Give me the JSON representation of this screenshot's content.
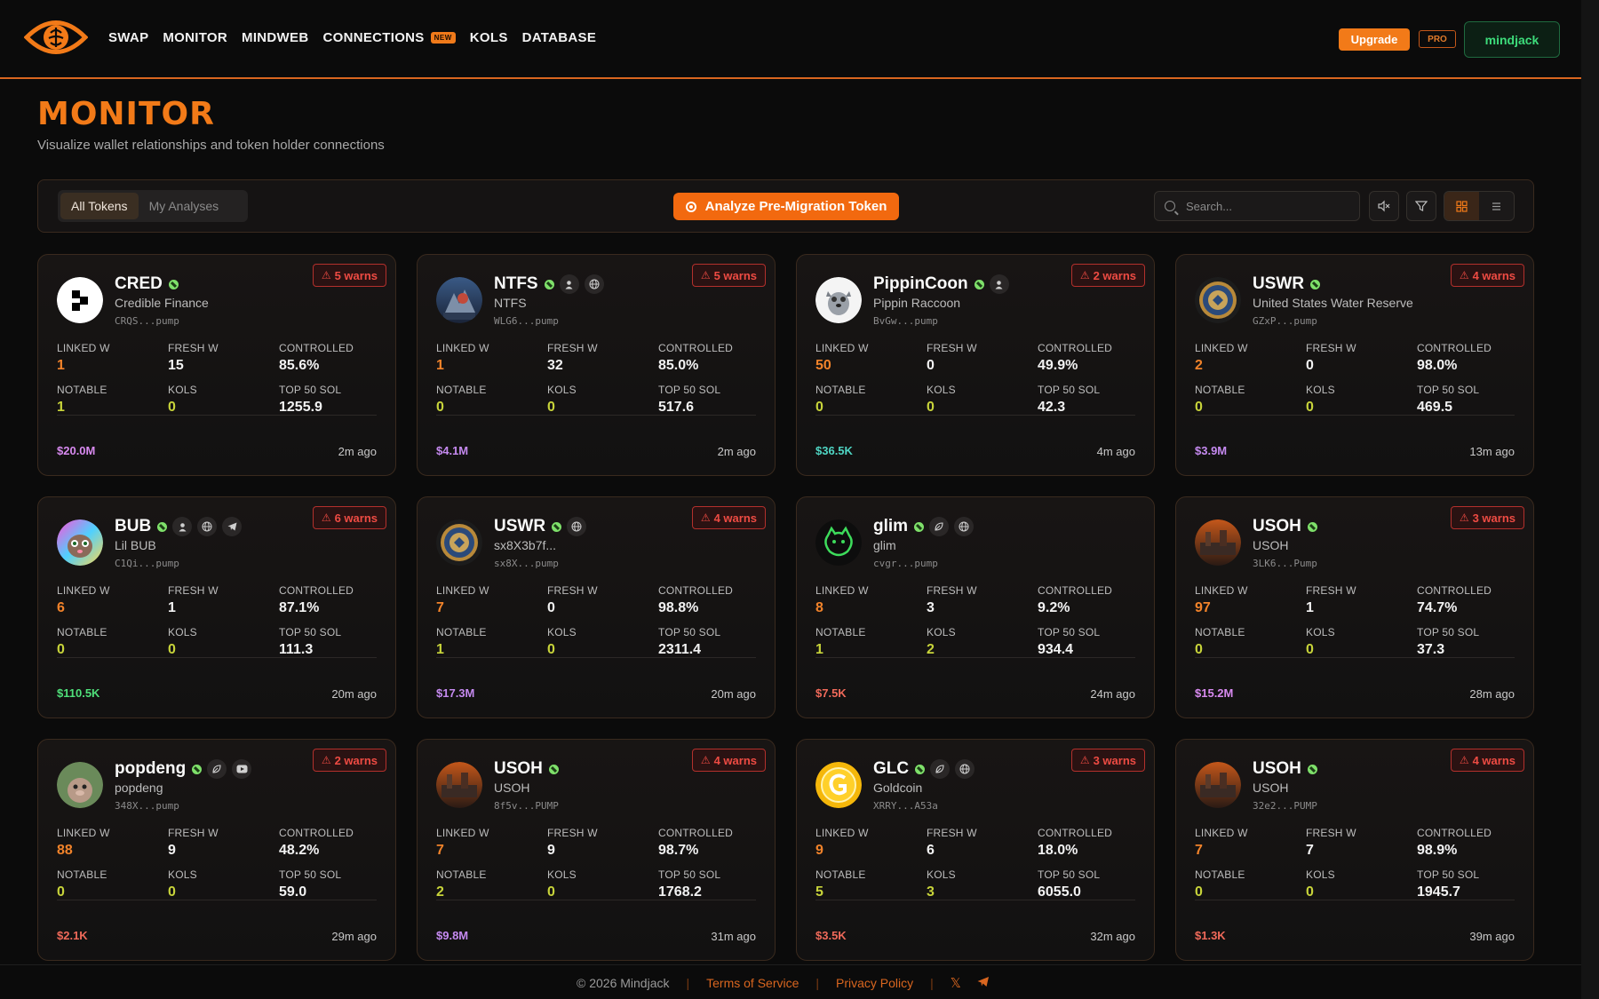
{
  "nav": {
    "items": [
      {
        "label": "SWAP"
      },
      {
        "label": "MONITOR"
      },
      {
        "label": "MINDWEB"
      },
      {
        "label": "CONNECTIONS",
        "badge": "NEW"
      },
      {
        "label": "KOLS"
      },
      {
        "label": "DATABASE"
      }
    ],
    "upgrade_label": "Upgrade",
    "pro_label": "PRO",
    "user_label": "mindjack"
  },
  "page": {
    "title": "MONITOR",
    "subtitle": "Visualize wallet relationships and token holder connections"
  },
  "toolbar": {
    "tabs": [
      {
        "label": "All Tokens",
        "active": true
      },
      {
        "label": "My Analyses",
        "active": false
      }
    ],
    "analyze_label": "Analyze Pre-Migration Token",
    "search_placeholder": "Search..."
  },
  "stat_labels": {
    "linked": "LINKED W",
    "fresh": "FRESH W",
    "controlled": "CONTROLLED",
    "notable": "NOTABLE",
    "kols": "KOLS",
    "top50": "TOP 50 SOL"
  },
  "colors": {
    "accent": "#f27a18",
    "warn": "#ee4b43",
    "green": "#3ddc7b"
  },
  "cards": [
    {
      "symbol": "CRED",
      "name": "Credible Finance",
      "address": "CRQS...pump",
      "warns": "5 warns",
      "socials": [],
      "avatar": "cred",
      "linked": "1",
      "fresh": "15",
      "controlled": "85.6%",
      "notable": "1",
      "kols": "0",
      "top50": "1255.9",
      "mcap": "$20.0M",
      "mcap_color": "#d88af0",
      "ago": "2m ago"
    },
    {
      "symbol": "NTFS",
      "name": "NTFS",
      "address": "WLG6...pump",
      "warns": "5 warns",
      "socials": [
        "person-icon",
        "globe-icon"
      ],
      "avatar": "ntfs",
      "linked": "1",
      "fresh": "32",
      "controlled": "85.0%",
      "notable": "0",
      "kols": "0",
      "top50": "517.6",
      "mcap": "$4.1M",
      "mcap_color": "#c58af0",
      "ago": "2m ago"
    },
    {
      "symbol": "PippinCoon",
      "name": "Pippin Raccoon",
      "address": "BvGw...pump",
      "warns": "2 warns",
      "socials": [
        "person-icon"
      ],
      "avatar": "pippin",
      "linked": "50",
      "fresh": "0",
      "controlled": "49.9%",
      "notable": "0",
      "kols": "0",
      "top50": "42.3",
      "mcap": "$36.5K",
      "mcap_color": "#4fd6c4",
      "ago": "4m ago"
    },
    {
      "symbol": "USWR",
      "name": "United States Water Reserve",
      "address": "GZxP...pump",
      "warns": "4 warns",
      "socials": [],
      "avatar": "seal",
      "linked": "2",
      "fresh": "0",
      "controlled": "98.0%",
      "notable": "0",
      "kols": "0",
      "top50": "469.5",
      "mcap": "$3.9M",
      "mcap_color": "#c58af0",
      "ago": "13m ago"
    },
    {
      "symbol": "BUB",
      "name": "Lil BUB",
      "address": "C1Qi...pump",
      "warns": "6 warns",
      "socials": [
        "person-icon",
        "globe-icon",
        "telegram-icon"
      ],
      "avatar": "bub",
      "linked": "6",
      "fresh": "1",
      "controlled": "87.1%",
      "notable": "0",
      "kols": "0",
      "top50": "111.3",
      "mcap": "$110.5K",
      "mcap_color": "#4fe07a",
      "ago": "20m ago"
    },
    {
      "symbol": "USWR",
      "name": "sx8X3b7f...",
      "address": "sx8X...pump",
      "warns": "4 warns",
      "socials": [
        "globe-icon"
      ],
      "avatar": "seal",
      "linked": "7",
      "fresh": "0",
      "controlled": "98.8%",
      "notable": "1",
      "kols": "0",
      "top50": "2311.4",
      "mcap": "$17.3M",
      "mcap_color": "#c58af0",
      "ago": "20m ago"
    },
    {
      "symbol": "glim",
      "name": "glim",
      "address": "cvgr...pump",
      "warns": "",
      "socials": [
        "leaf-icon",
        "globe-icon"
      ],
      "avatar": "glim",
      "linked": "8",
      "fresh": "3",
      "controlled": "9.2%",
      "notable": "1",
      "kols": "2",
      "top50": "934.4",
      "mcap": "$7.5K",
      "mcap_color": "#f06a5a",
      "ago": "24m ago"
    },
    {
      "symbol": "USOH",
      "name": "USOH",
      "address": "3LK6...Pump",
      "warns": "3 warns",
      "socials": [],
      "avatar": "usoh",
      "linked": "97",
      "fresh": "1",
      "controlled": "74.7%",
      "notable": "0",
      "kols": "0",
      "top50": "37.3",
      "mcap": "$15.2M",
      "mcap_color": "#d88af0",
      "ago": "28m ago"
    },
    {
      "symbol": "popdeng",
      "name": "popdeng",
      "address": "348X...pump",
      "warns": "2 warns",
      "socials": [
        "leaf-icon",
        "youtube-icon"
      ],
      "avatar": "popdeng",
      "linked": "88",
      "fresh": "9",
      "controlled": "48.2%",
      "notable": "0",
      "kols": "0",
      "top50": "59.0",
      "mcap": "$2.1K",
      "mcap_color": "#f06a5a",
      "ago": "29m ago"
    },
    {
      "symbol": "USOH",
      "name": "USOH",
      "address": "8f5v...PUMP",
      "warns": "4 warns",
      "socials": [],
      "avatar": "usoh",
      "linked": "7",
      "fresh": "9",
      "controlled": "98.7%",
      "notable": "2",
      "kols": "0",
      "top50": "1768.2",
      "mcap": "$9.8M",
      "mcap_color": "#c58af0",
      "ago": "31m ago"
    },
    {
      "symbol": "GLC",
      "name": "Goldcoin",
      "address": "XRRY...A53a",
      "warns": "3 warns",
      "socials": [
        "leaf-icon",
        "globe-icon"
      ],
      "avatar": "glc",
      "linked": "9",
      "fresh": "6",
      "controlled": "18.0%",
      "notable": "5",
      "kols": "3",
      "top50": "6055.0",
      "mcap": "$3.5K",
      "mcap_color": "#f06a5a",
      "ago": "32m ago"
    },
    {
      "symbol": "USOH",
      "name": "USOH",
      "address": "32e2...PUMP",
      "warns": "4 warns",
      "socials": [],
      "avatar": "usoh",
      "linked": "7",
      "fresh": "7",
      "controlled": "98.9%",
      "notable": "0",
      "kols": "0",
      "top50": "1945.7",
      "mcap": "$1.3K",
      "mcap_color": "#f06a5a",
      "ago": "39m ago"
    }
  ],
  "footer": {
    "copyright": "© 2026 Mindjack",
    "terms": "Terms of Service",
    "privacy": "Privacy Policy"
  }
}
